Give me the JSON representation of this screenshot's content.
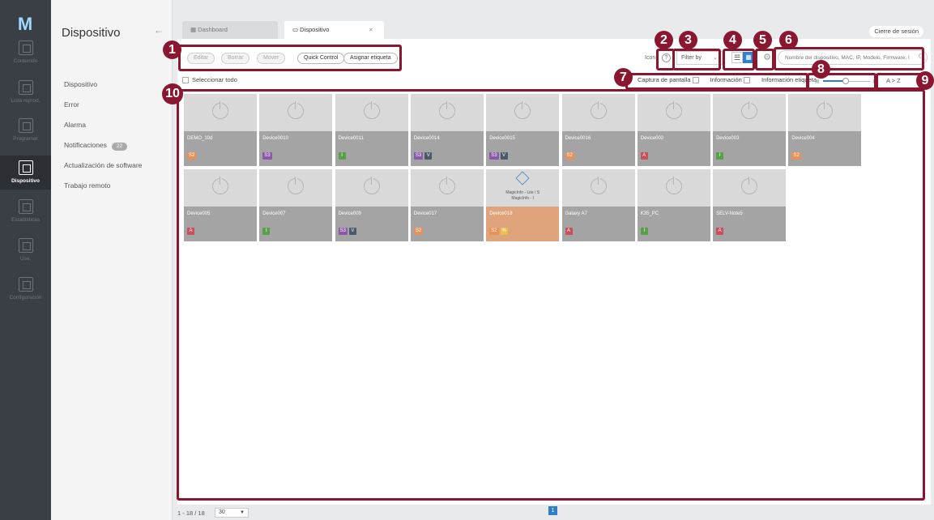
{
  "rail": {
    "logo": "M",
    "items": [
      {
        "label": "Contenido",
        "icon": "content-icon"
      },
      {
        "label": "Lista reprod.",
        "icon": "playlist-icon"
      },
      {
        "label": "Programar",
        "icon": "schedule-icon"
      },
      {
        "label": "Dispositivo",
        "icon": "device-icon",
        "active": true
      },
      {
        "label": "Estadísticas",
        "icon": "statistics-icon"
      },
      {
        "label": "Usu.",
        "icon": "user-icon"
      },
      {
        "label": "Configuración",
        "icon": "settings-icon"
      }
    ]
  },
  "sidebar": {
    "title": "Dispositivo",
    "collapse_icon": "←",
    "items": [
      {
        "label": "Dispositivo"
      },
      {
        "label": "Error"
      },
      {
        "label": "Alarma"
      },
      {
        "label": "Notificaciones",
        "badge": "22"
      },
      {
        "label": "Actualización de software"
      },
      {
        "label": "Trabajo remoto"
      }
    ]
  },
  "tabs": {
    "dashboard": "Dashboard",
    "device": "Dispositivo",
    "close": "×"
  },
  "logout": "Cierre de sesión",
  "toolbar": {
    "edit": "Editar",
    "delete": "Borrar",
    "move": "Mover",
    "quick_control": "Quick Control",
    "assign_tag": "Asignar etiqueta",
    "icon_label": "Icon",
    "help": "?",
    "filter": "Filter by",
    "search_placeholder": "Nombre del dispositivo, MAC, IP, Modelo, Firmware, I"
  },
  "options": {
    "select_all": "Seleccionar todo",
    "screenshot": "Captura de pantalla",
    "info": "Información",
    "tag_info": "Información etiqueta",
    "sort": "A > Z"
  },
  "colors": {
    "S2": "#e8925a",
    "S3": "#8a5aa8",
    "I": "#5aa04a",
    "V": "#4a5a6a",
    "A": "#c8505a",
    "%": "#e8c050"
  },
  "devices": [
    {
      "name": "DEMO_10d",
      "tags": [
        "S2"
      ]
    },
    {
      "name": "Device0010",
      "tags": [
        "S3"
      ]
    },
    {
      "name": "Device0011",
      "tags": [
        "I"
      ]
    },
    {
      "name": "Device0014",
      "tags": [
        "S3",
        "V"
      ]
    },
    {
      "name": "Device0015",
      "tags": [
        "S3",
        "V"
      ]
    },
    {
      "name": "Device0016",
      "tags": [
        "S2"
      ]
    },
    {
      "name": "Device002",
      "tags": [
        "A"
      ]
    },
    {
      "name": "Device003",
      "tags": [
        "I"
      ]
    },
    {
      "name": "Device004",
      "tags": [
        "S2"
      ]
    },
    {
      "name": "Device005",
      "tags": [
        "A"
      ]
    },
    {
      "name": "Device007",
      "tags": [
        "I"
      ]
    },
    {
      "name": "Device009",
      "tags": [
        "S3",
        "V"
      ]
    },
    {
      "name": "Device017",
      "tags": [
        "S2"
      ]
    },
    {
      "name": "Device018",
      "tags": [
        "S2",
        "%"
      ],
      "selected": true,
      "preview_line1": "MagicInfo - Lite / S",
      "preview_line2": "MagicInfo - I"
    },
    {
      "name": "Galaxy A7",
      "tags": [
        "A"
      ]
    },
    {
      "name": "K35_PC",
      "tags": [
        "I"
      ]
    },
    {
      "name": "SELV-Note5",
      "tags": [
        "A"
      ]
    }
  ],
  "pagination": {
    "range": "1 - 18 / 18",
    "page_size": "30",
    "current_page": "1"
  },
  "callouts": [
    "1",
    "2",
    "3",
    "4",
    "5",
    "6",
    "7",
    "8",
    "9",
    "10"
  ]
}
